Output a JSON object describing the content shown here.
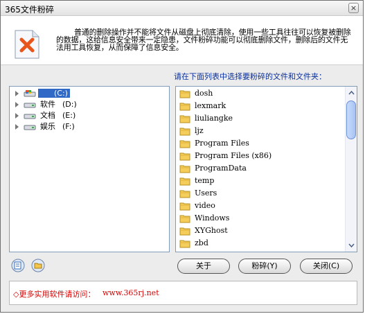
{
  "window": {
    "title": "365文件粉碎",
    "close_glyph": "×"
  },
  "header": {
    "description": "普通的删除操作并不能将文件从磁盘上彻底清除，使用一些工具往往可以恢复被删除的数据，这给信息安全带来一定隐患，文件粉碎功能可以彻底删除文件，删除后的文件无法用工具恢复，从而保障了信息安全。",
    "icon": "delete-document-icon"
  },
  "hint": "请在下面列表中选择要粉碎的文件和文件夹：",
  "drives": [
    {
      "name": "",
      "letter": "(C:)",
      "selected": true,
      "icon": "system-drive-icon"
    },
    {
      "name": "软件",
      "letter": "(D:)",
      "selected": false,
      "icon": "hard-drive-icon"
    },
    {
      "name": "文档",
      "letter": "(E:)",
      "selected": false,
      "icon": "hard-drive-icon"
    },
    {
      "name": "娱乐",
      "letter": "(F:)",
      "selected": false,
      "icon": "hard-drive-icon"
    }
  ],
  "files": [
    "dosh",
    "lexmark",
    "liuliangke",
    "ljz",
    "Program Files",
    "Program Files (x86)",
    "ProgramData",
    "temp",
    "Users",
    "video",
    "Windows",
    "XYGhost",
    "zbd"
  ],
  "buttons": {
    "about": "关于",
    "shred": "粉碎(Y)",
    "close": "关闭(C)"
  },
  "footer": {
    "label": "◇更多实用软件请访问：",
    "url": "www.365rj.net"
  },
  "colors": {
    "accent": "#3169c6",
    "link": "#d80000",
    "hint": "#0a2f9c"
  }
}
